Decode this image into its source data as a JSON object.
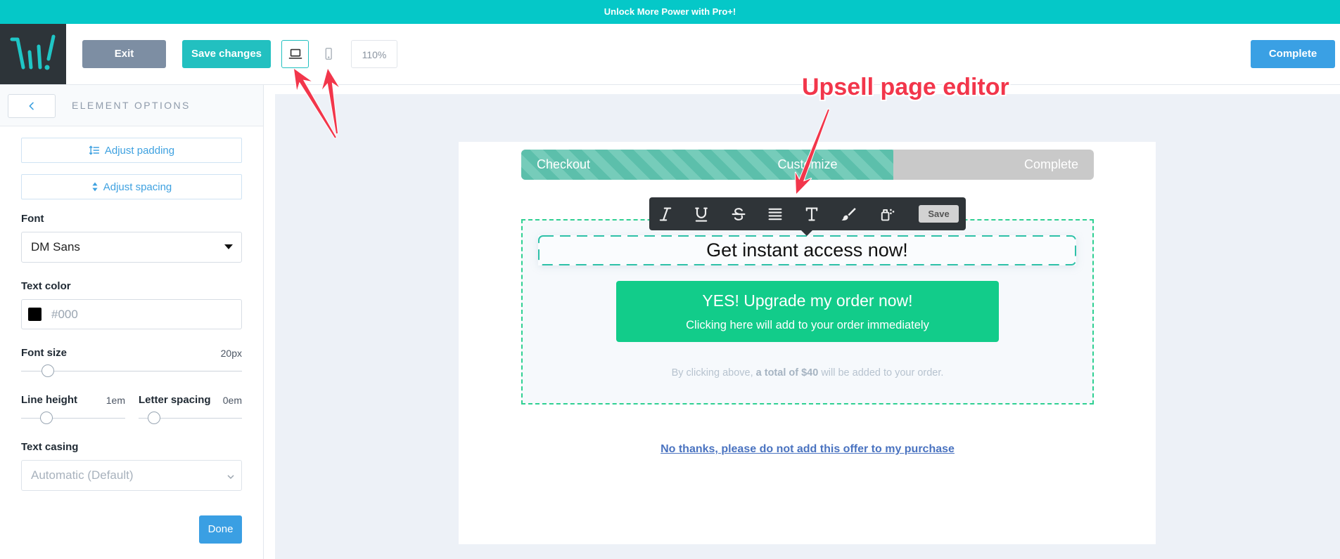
{
  "banner": {
    "text": "Unlock More Power with Pro+!"
  },
  "header": {
    "logo_icon": "logo-icon",
    "exit_label": "Exit",
    "save_label": "Save changes",
    "desktop_view_icon": "laptop-icon",
    "mobile_view_icon": "mobile-icon",
    "zoom": "110%",
    "complete_label": "Complete"
  },
  "sidebar": {
    "back_icon": "chevron-left-icon",
    "title": "ELEMENT OPTIONS",
    "adjust_padding": {
      "label": "Adjust padding",
      "icon": "line-height-icon"
    },
    "adjust_spacing": {
      "label": "Adjust spacing",
      "icon": "sort-icon"
    },
    "font": {
      "label": "Font",
      "value": "DM Sans",
      "icon": "caret-down-icon"
    },
    "text_color": {
      "label": "Text color",
      "placeholder": "#000",
      "swatch": "#000000"
    },
    "font_size": {
      "label": "Font size",
      "value": "20px",
      "level": 0.12
    },
    "line_height": {
      "label": "Line height",
      "value": "1em",
      "level": 0.24
    },
    "letter_spacing": {
      "label": "Letter spacing",
      "value": "0em",
      "level": 0.15
    },
    "text_casing": {
      "label": "Text casing",
      "value": "Automatic (Default)",
      "icon": "chevron-down-icon"
    },
    "done_label": "Done"
  },
  "canvas": {
    "progress": {
      "steps": [
        "Checkout",
        "Customize",
        "Complete"
      ],
      "level": 0.65
    },
    "toolbar": {
      "icons": [
        "italic-icon",
        "underline-icon",
        "strikethrough-icon",
        "align-justify-icon",
        "text-type-icon",
        "brush-icon",
        "paint-bucket-icon"
      ],
      "save_label": "Save"
    },
    "heading": "Get instant access now!",
    "cta": {
      "title": "YES! Upgrade my order now!",
      "subtitle": "Clicking here will add to your order immediately"
    },
    "fine_print": {
      "before": "By clicking above, ",
      "bold": "a total of $40",
      "after": " will be added to your order."
    },
    "decline_link": "No thanks, please do not add this offer to my purchase"
  },
  "annotation": {
    "text": "Upsell page editor",
    "color": "#f2364b"
  },
  "colors": {
    "banner": "#05c8c8",
    "primary_teal": "#22c0c0",
    "complete_blue": "#3aa0e4",
    "cta_green": "#12cc8a",
    "exit_gray": "#7d8ea3",
    "dashed_green": "#2fd092"
  }
}
